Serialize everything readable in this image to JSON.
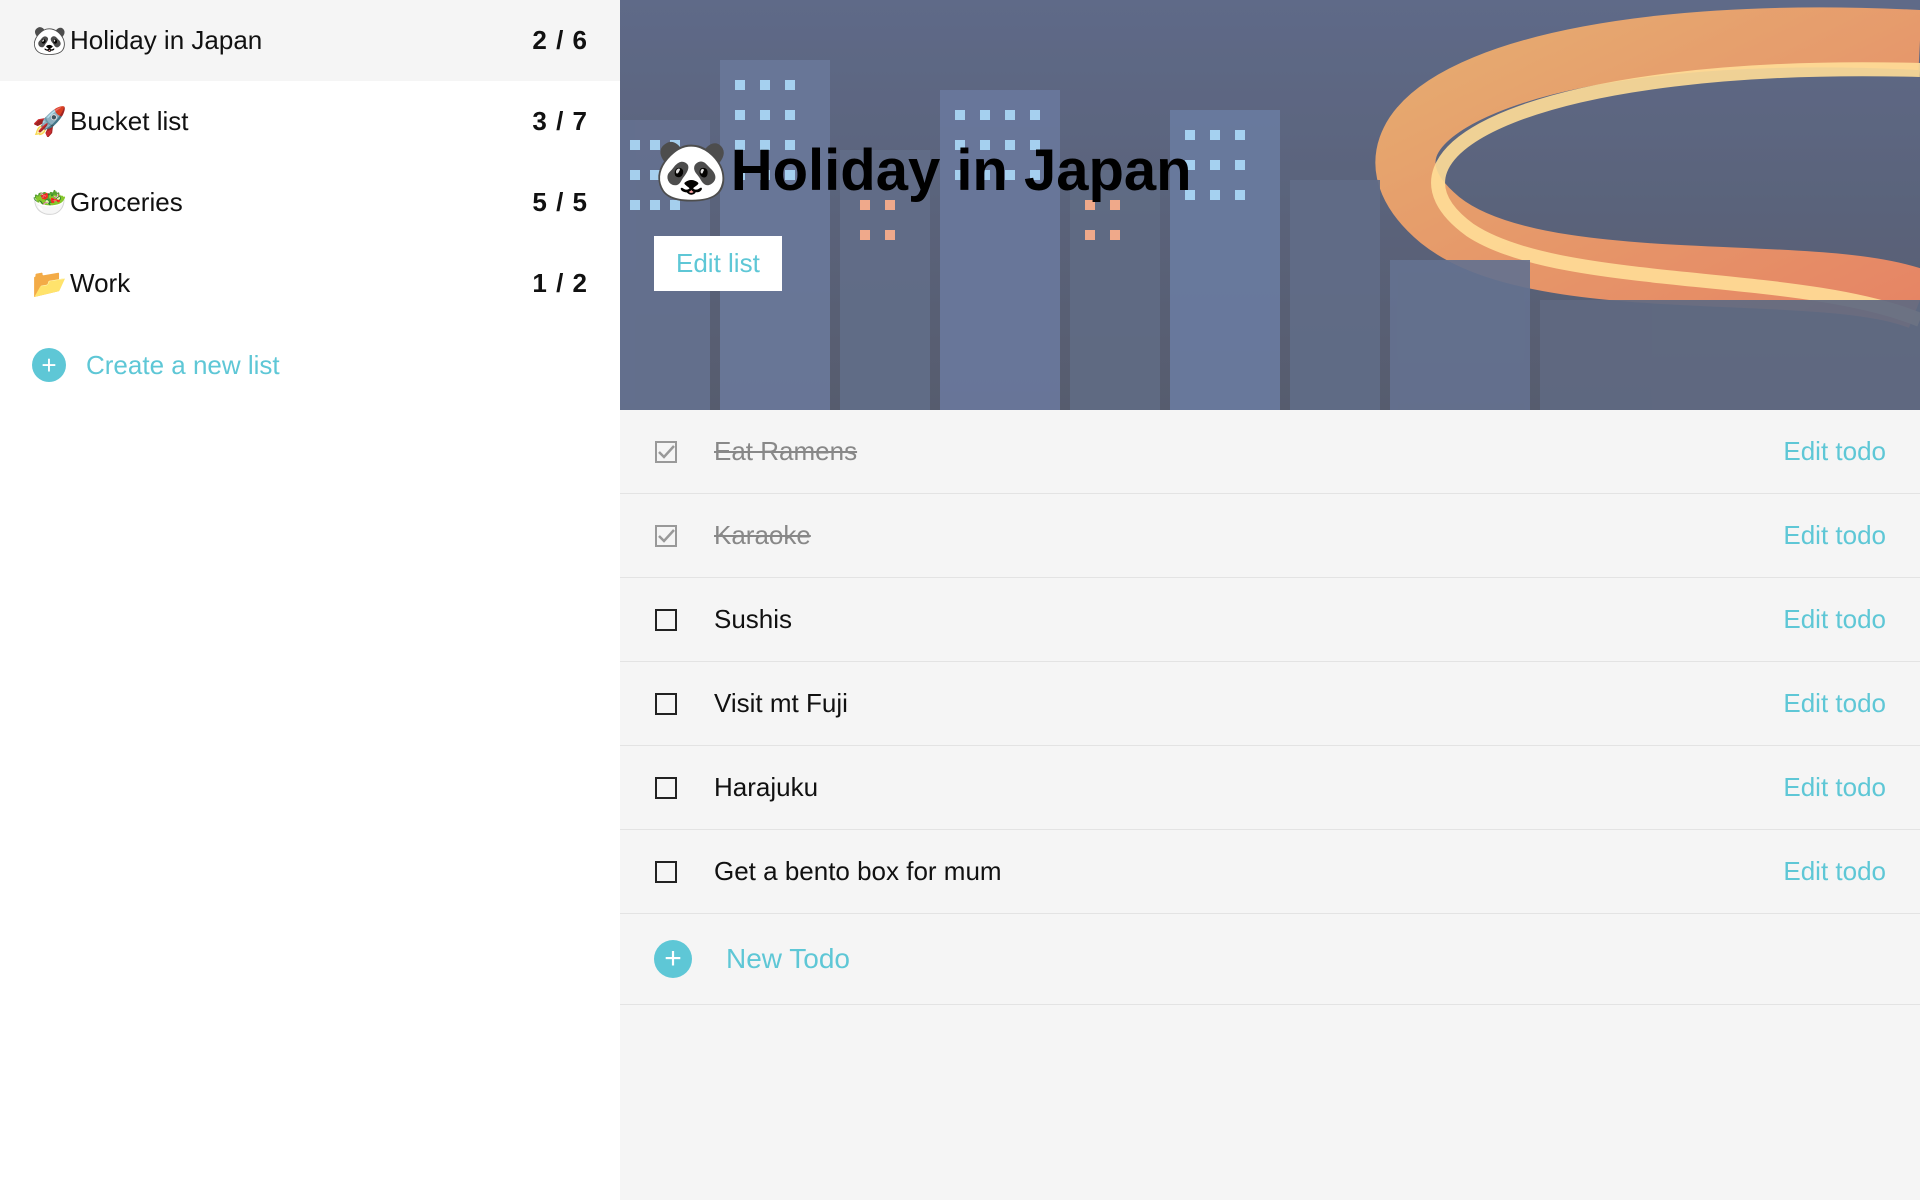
{
  "sidebar": {
    "items": [
      {
        "icon": "🐼",
        "label": "Holiday in Japan",
        "count": "2 / 6",
        "active": true
      },
      {
        "icon": "🚀",
        "label": "Bucket list",
        "count": "3 / 7",
        "active": false
      },
      {
        "icon": "🥗",
        "label": "Groceries",
        "count": "5 / 5",
        "active": false
      },
      {
        "icon": "📂",
        "label": "Work",
        "count": "1 / 2",
        "active": false
      }
    ],
    "create_label": "Create a new list"
  },
  "header": {
    "icon": "🐼",
    "title": "Holiday in Japan",
    "edit_list_label": "Edit list"
  },
  "todos": {
    "edit_label": "Edit todo",
    "new_label": "New Todo",
    "items": [
      {
        "label": "Eat Ramens",
        "done": true
      },
      {
        "label": "Karaoke",
        "done": true
      },
      {
        "label": "Sushis",
        "done": false
      },
      {
        "label": "Visit mt Fuji",
        "done": false
      },
      {
        "label": "Harajuku",
        "done": false
      },
      {
        "label": "Get a bento box for mum",
        "done": false
      }
    ]
  },
  "colors": {
    "accent": "#5ec7d6"
  }
}
